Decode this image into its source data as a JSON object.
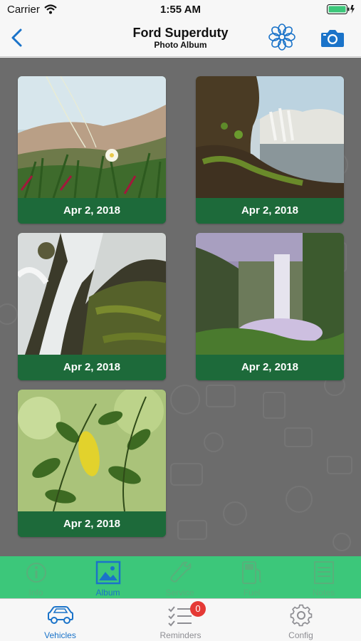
{
  "status_bar": {
    "carrier": "Carrier",
    "time": "1:55 AM"
  },
  "nav": {
    "title": "Ford Superduty",
    "subtitle": "Photo Album"
  },
  "photos": [
    {
      "date": "Apr 2, 2018",
      "scene": "flower-grass"
    },
    {
      "date": "Apr 2, 2018",
      "scene": "cliff-waterfall"
    },
    {
      "date": "Apr 2, 2018",
      "scene": "mossy-waterfall"
    },
    {
      "date": "Apr 2, 2018",
      "scene": "misty-falls"
    },
    {
      "date": "Apr 2, 2018",
      "scene": "green-leaves"
    }
  ],
  "section_tabs": [
    {
      "label": "Info",
      "icon": "info-icon"
    },
    {
      "label": "Album",
      "icon": "album-icon",
      "active": true
    },
    {
      "label": "Service",
      "icon": "wrench-icon"
    },
    {
      "label": "Fuel",
      "icon": "fuel-icon"
    },
    {
      "label": "Notes",
      "icon": "notes-icon"
    }
  ],
  "tab_bar": [
    {
      "label": "Vehicles",
      "icon": "car-icon",
      "active": true
    },
    {
      "label": "Reminders",
      "icon": "list-icon",
      "badge": "0"
    },
    {
      "label": "Config",
      "icon": "gear-icon"
    }
  ],
  "colors": {
    "accent": "#1a73c9",
    "card_green": "#1d6a3a",
    "toolbar_green": "#3cc77a",
    "content_bg": "#6c6c6c",
    "badge_red": "#e53935"
  }
}
